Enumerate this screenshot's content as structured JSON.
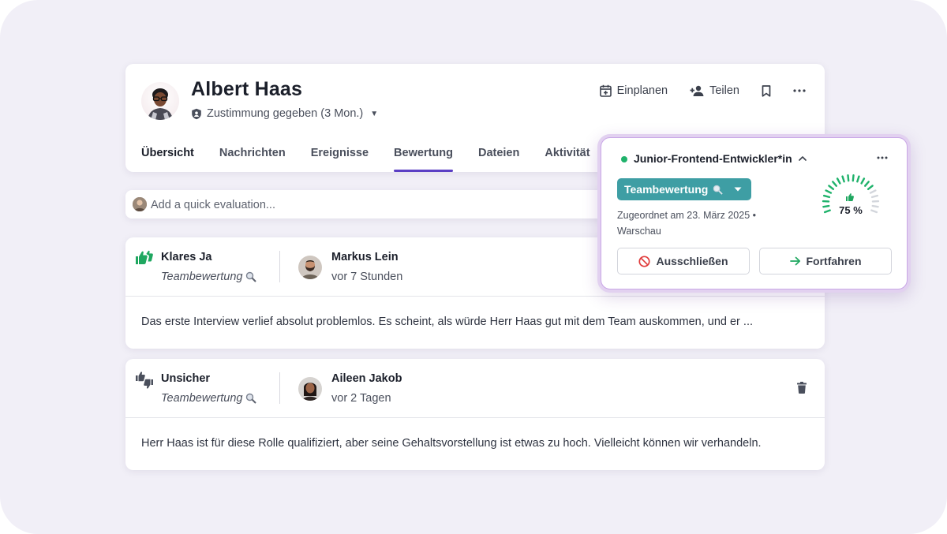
{
  "candidate": {
    "name": "Albert Haas",
    "consent": "Zustimmung gegeben (3 Mon.)"
  },
  "header_actions": {
    "schedule": "Einplanen",
    "share": "Teilen"
  },
  "tabs": [
    {
      "label": "Übersicht"
    },
    {
      "label": "Nachrichten"
    },
    {
      "label": "Ereignisse"
    },
    {
      "label": "Bewertung"
    },
    {
      "label": "Dateien"
    },
    {
      "label": "Aktivität"
    }
  ],
  "quick_eval": {
    "placeholder": "Add a quick evaluation..."
  },
  "evaluations": [
    {
      "verdict": "Klares Ja",
      "type": "Teambewertung",
      "reviewer": "Markus Lein",
      "time": "vor 7 Stunden",
      "text": "Das erste Interview verlief absolut problemlos. Es scheint, als würde Herr Haas gut mit dem Team auskommen, und er ..."
    },
    {
      "verdict": "Unsicher",
      "type": "Teambewertung",
      "reviewer": "Aileen Jakob",
      "time": "vor 2 Tagen",
      "text": "Herr Haas ist für diese Rolle qualifiziert, aber seine Gehaltsvorstellung ist etwas zu hoch. Vielleicht können wir verhandeln."
    }
  ],
  "job_popover": {
    "job_title": "Junior-Frontend-Entwickler*in",
    "status_color": "#1fb26b",
    "evaluation_badge": "Teambewertung",
    "assigned": "Zugeordnet am 23. März 2025 •",
    "location": "Warschau",
    "score_percent": 75,
    "score_label": "75 %",
    "exclude_label": "Ausschließen",
    "continue_label": "Fortfahren"
  },
  "colors": {
    "accent": "#5b3fc4",
    "positive": "#1fb26b",
    "badge": "#3e9ea4",
    "danger": "#e03a3a"
  }
}
